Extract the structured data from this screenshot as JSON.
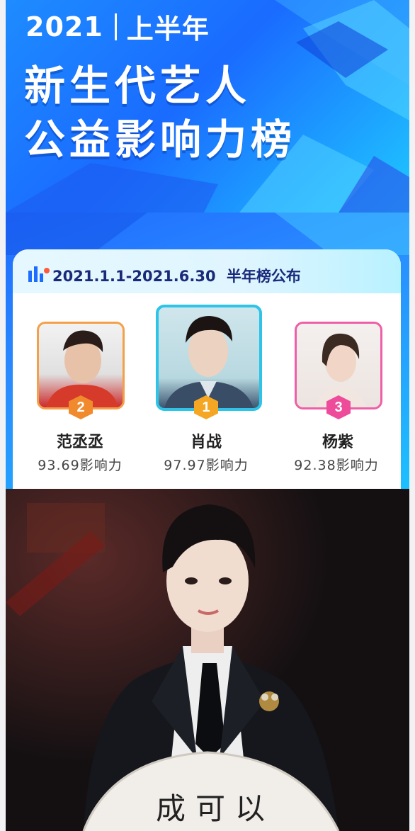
{
  "banner": {
    "year": "2021",
    "half": "上半年",
    "title_line1": "新生代艺人",
    "title_line2": "公益影响力榜"
  },
  "ranking": {
    "period": "2021.1.1-2021.6.30",
    "announce": "半年榜公布",
    "entries": [
      {
        "rank": "2",
        "name": "范丞丞",
        "score": "93.69影响力",
        "color": "#f08a2c"
      },
      {
        "rank": "1",
        "name": "肖战",
        "score": "97.97影响力",
        "color": "#f5a623"
      },
      {
        "rank": "3",
        "name": "杨紫",
        "score": "92.38影响力",
        "color": "#ee4b9b"
      }
    ]
  },
  "photo": {
    "fan_text": "成可以"
  }
}
